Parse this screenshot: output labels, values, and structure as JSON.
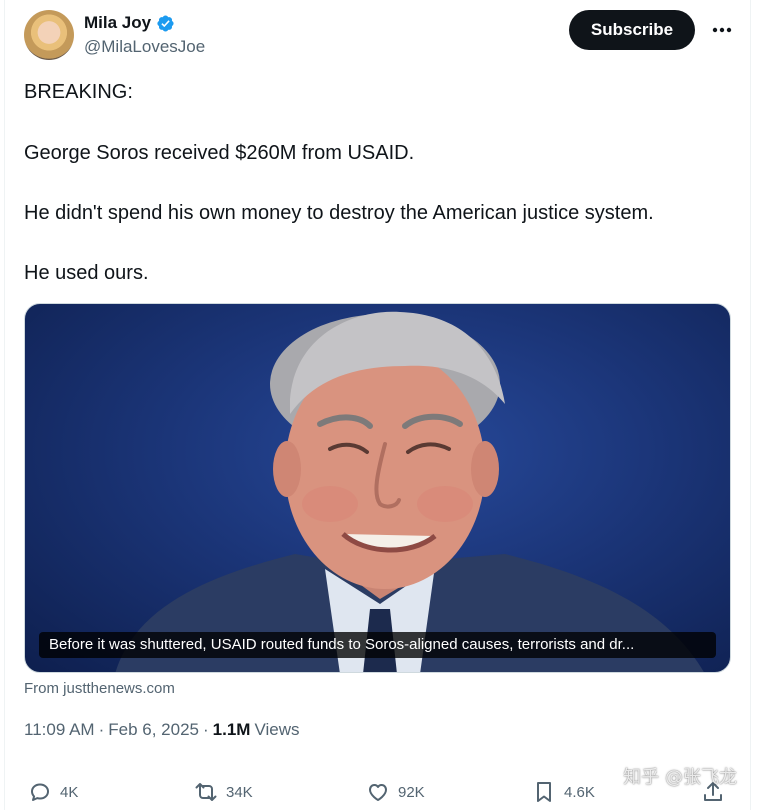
{
  "author": {
    "name": "Mila Joy",
    "handle": "@MilaLovesJoe",
    "verified": true,
    "avatar_icon": "profile-photo"
  },
  "header": {
    "subscribe_label": "Subscribe",
    "more_icon": "ellipsis-icon"
  },
  "tweet": {
    "lines": [
      "BREAKING:",
      "George Soros received $260M from USAID.",
      "He didn't spend his own money to destroy the American justice system.",
      "He used ours."
    ]
  },
  "media": {
    "caption": "Before it was shuttered, USAID routed funds to Soros-aligned causes, terrorists and dr...",
    "source": "From justthenews.com"
  },
  "meta": {
    "time": "11:09 AM",
    "separator": "·",
    "date": "Feb 6, 2025",
    "views_count": "1.1M",
    "views_label": "Views"
  },
  "actions": {
    "replies": "4K",
    "reposts": "34K",
    "likes": "92K",
    "bookmarks": "4.6K"
  },
  "watermark": "知乎 @张飞龙",
  "colors": {
    "verified_blue": "#1d9bf0",
    "secondary_text": "#536471",
    "primary_text": "#0f1419"
  }
}
